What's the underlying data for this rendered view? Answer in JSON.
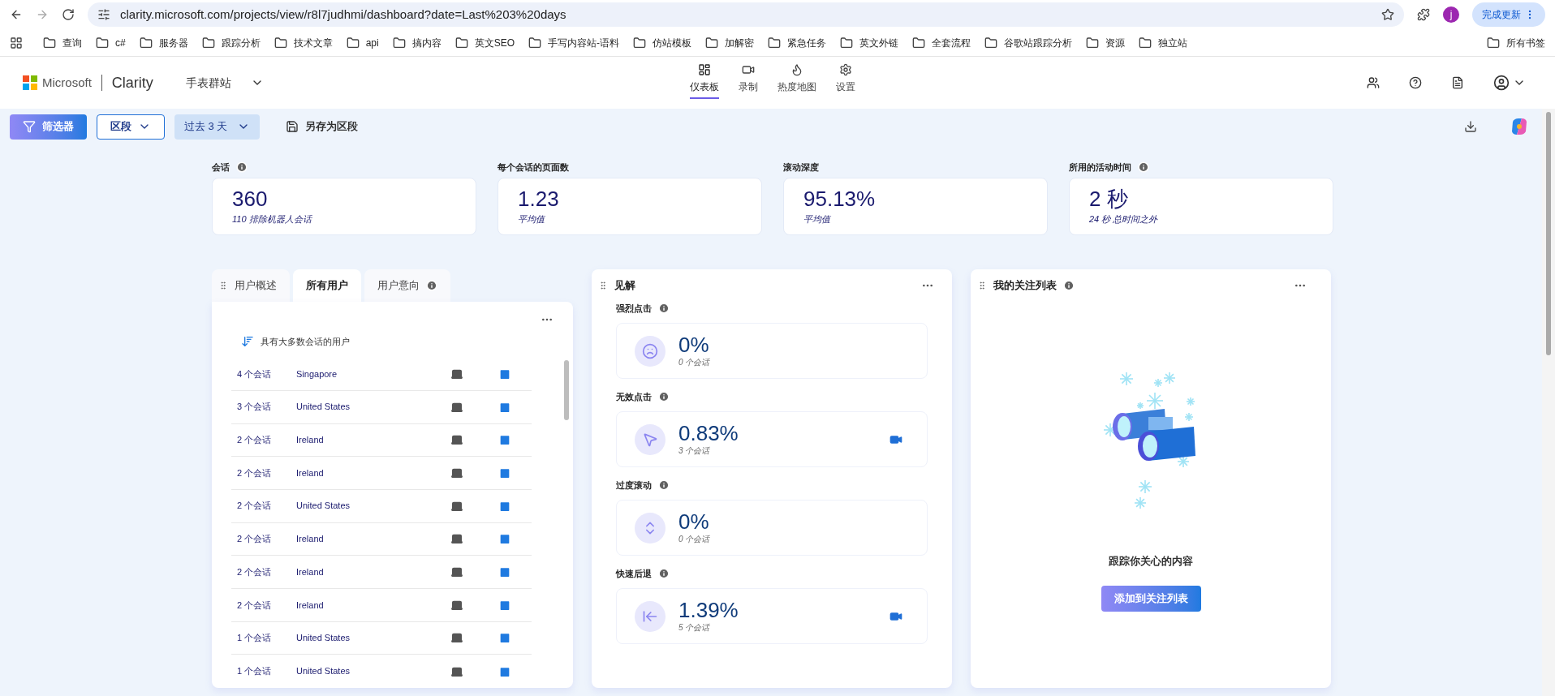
{
  "browser": {
    "url": "clarity.microsoft.com/projects/view/r8l7judhmi/dashboard?date=Last%203%20days",
    "profile_initial": "j",
    "update_button": "完成更新",
    "bookmarks": [
      "查询",
      "c#",
      "服务器",
      "跟踪分析",
      "技术文章",
      "api",
      "搞内容",
      "英文SEO",
      "手写内容站-语料",
      "仿站模板",
      "加解密",
      "紧急任务",
      "英文外链",
      "全套流程",
      "谷歌站跟踪分析",
      "资源",
      "独立站"
    ],
    "all_bookmarks": "所有书签"
  },
  "header": {
    "brand": "Microsoft",
    "product": "Clarity",
    "project": "手表群站",
    "nav": [
      {
        "label": "仪表板",
        "kind": "dashboard",
        "selected": true
      },
      {
        "label": "录制",
        "kind": "recordings",
        "selected": false
      },
      {
        "label": "热度地图",
        "kind": "heatmaps",
        "selected": false
      },
      {
        "label": "设置",
        "kind": "settings",
        "selected": false
      }
    ]
  },
  "toolbar": {
    "filter": "筛选器",
    "segment": "区段",
    "date": "过去 3 天",
    "save": "另存为区段"
  },
  "stats": [
    {
      "label": "会话",
      "info": true,
      "value": "360",
      "sub": "110 排除机器人会话"
    },
    {
      "label": "每个会话的页面数",
      "info": false,
      "value": "1.23",
      "sub": "平均值"
    },
    {
      "label": "滚动深度",
      "info": false,
      "value": "95.13%",
      "sub": "平均值"
    },
    {
      "label": "所用的活动时间",
      "info": true,
      "value": "2 秒",
      "sub": "24 秒 总时间之外"
    }
  ],
  "users_panel": {
    "tabs": [
      {
        "label": "用户概述",
        "selected": false,
        "info": false
      },
      {
        "label": "所有用户",
        "selected": true,
        "info": false
      },
      {
        "label": "用户意向",
        "selected": false,
        "info": true
      }
    ],
    "sort_label": "具有大多数会话的用户",
    "rows": [
      {
        "sessions": "4 个会话",
        "country": "Singapore"
      },
      {
        "sessions": "3 个会话",
        "country": "United States"
      },
      {
        "sessions": "2 个会话",
        "country": "Ireland"
      },
      {
        "sessions": "2 个会话",
        "country": "Ireland"
      },
      {
        "sessions": "2 个会话",
        "country": "United States"
      },
      {
        "sessions": "2 个会话",
        "country": "Ireland"
      },
      {
        "sessions": "2 个会话",
        "country": "Ireland"
      },
      {
        "sessions": "2 个会话",
        "country": "Ireland"
      },
      {
        "sessions": "1 个会话",
        "country": "United States"
      },
      {
        "sessions": "1 个会话",
        "country": "United States"
      }
    ]
  },
  "insights": {
    "title": "见解",
    "items": [
      {
        "label": "强烈点击",
        "kind": "rage",
        "value": "0%",
        "sub": "0 个会话",
        "recording": false
      },
      {
        "label": "无效点击",
        "kind": "dead",
        "value": "0.83%",
        "sub": "3 个会话",
        "recording": true
      },
      {
        "label": "过度滚动",
        "kind": "scroll",
        "value": "0%",
        "sub": "0 个会话",
        "recording": false
      },
      {
        "label": "快速后退",
        "kind": "back",
        "value": "1.39%",
        "sub": "5 个会话",
        "recording": true
      }
    ]
  },
  "watchlist": {
    "title": "我的关注列表",
    "message": "跟踪你关心的内容",
    "button": "添加到关注列表"
  }
}
